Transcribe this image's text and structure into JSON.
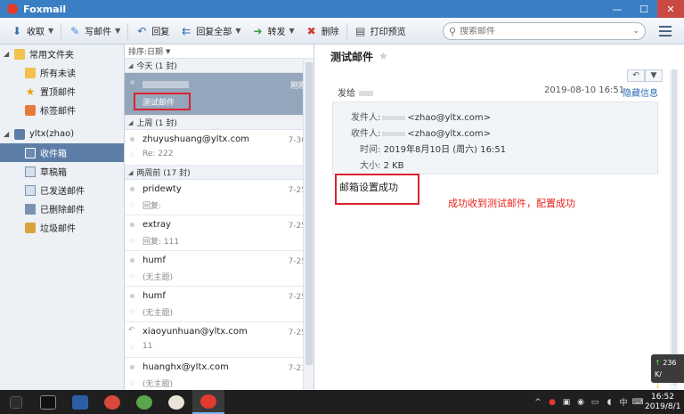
{
  "window": {
    "title": "Foxmail"
  },
  "toolbar": {
    "receive": "收取",
    "compose": "写邮件",
    "reply": "回复",
    "reply_all": "回复全部",
    "forward": "转发",
    "delete": "删除",
    "print_preview": "打印预览",
    "search_placeholder": "搜索邮件"
  },
  "sidebar": {
    "common_folders": "常用文件夹",
    "all_unread": "所有未读",
    "starred": "置顶邮件",
    "tagged": "标签邮件",
    "account": "yltx(zhao)",
    "inbox": "收件箱",
    "drafts": "草稿箱",
    "sent": "已发送邮件",
    "deleted": "已删除邮件",
    "junk": "垃圾邮件"
  },
  "list": {
    "sort_label": "排序:日期",
    "groups": {
      "today": "今天 (1 封)",
      "last_week": "上周 (1 封)",
      "two_weeks": "两周前 (17 封)"
    },
    "selected": {
      "subject": "测试邮件",
      "date": "刚刚"
    },
    "mails": [
      {
        "from": "zhuyushuang@yltx.com",
        "subject": "Re: 222",
        "date": "7-30"
      },
      {
        "from": "pridewty",
        "subject": "回复:",
        "date": "7-25"
      },
      {
        "from": "extray",
        "subject": "回复: 111",
        "date": "7-25"
      },
      {
        "from": "humf",
        "subject": "(无主题)",
        "date": "7-25"
      },
      {
        "from": "humf",
        "subject": "(无主题)",
        "date": "7-25"
      },
      {
        "from": "xiaoyunhuan@yltx.com",
        "subject": "11",
        "date": "7-25"
      },
      {
        "from": "huanghx@yltx.com",
        "subject": "(无主题)",
        "date": "7-23"
      }
    ]
  },
  "reader": {
    "subject": "测试邮件",
    "to_label": "发给",
    "datetime": "2019-08-10 16:51",
    "hide_info": "隐藏信息",
    "from_label": "发件人:",
    "from_addr": "<zhao@yltx.com>",
    "recipient_label": "收件人:",
    "recipient_addr": "<zhao@yltx.com>",
    "time_label": "时间:",
    "time_value": "2019年8月10日 (周六) 16:51",
    "size_label": "大小:",
    "size_value": "2 KB",
    "body": "邮箱设置成功",
    "annotation": "成功收到测试邮件，配置成功"
  },
  "taskbar": {
    "ime": "中",
    "time": "16:52",
    "date": "2019/8/1"
  },
  "netmon": {
    "up": "236 K/",
    "down": "8.9 K/"
  }
}
